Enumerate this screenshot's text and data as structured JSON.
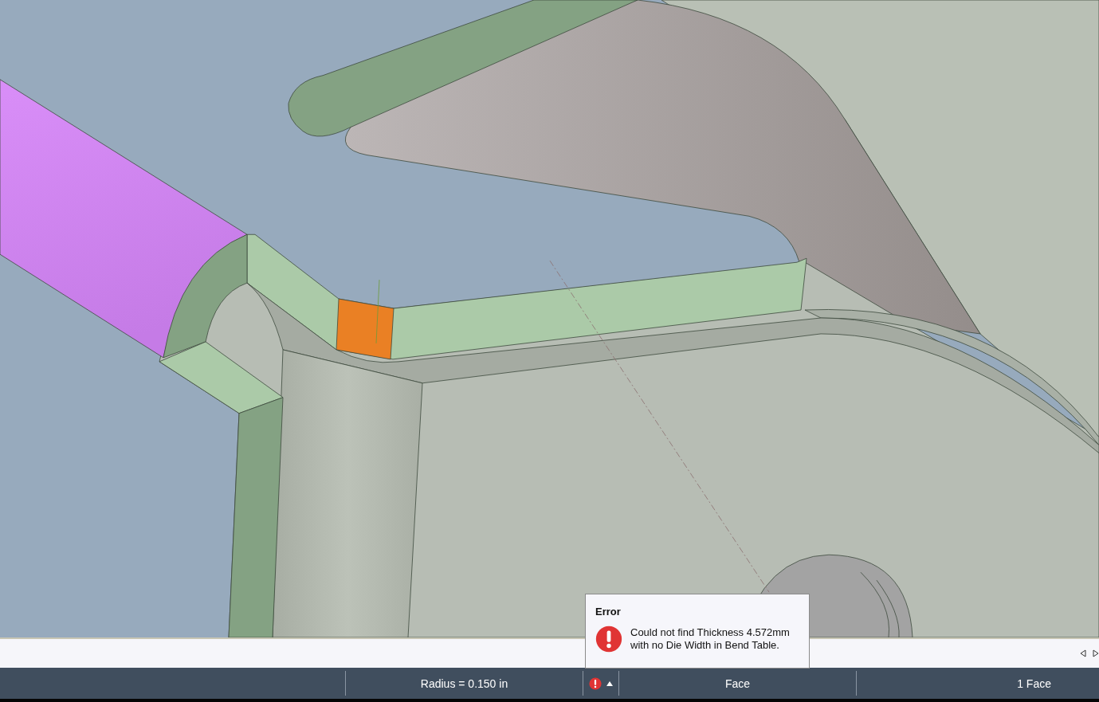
{
  "error_tooltip": {
    "title": "Error",
    "message": "Could not find Thickness 4.572mm with no Die Width in Bend Table."
  },
  "status_bar": [
    {
      "kind": "empty"
    },
    {
      "kind": "text",
      "text": "Radius = 0.150 in"
    },
    {
      "kind": "alerts"
    },
    {
      "kind": "text",
      "text": "Face"
    },
    {
      "kind": "count",
      "text": "1 Face"
    }
  ]
}
